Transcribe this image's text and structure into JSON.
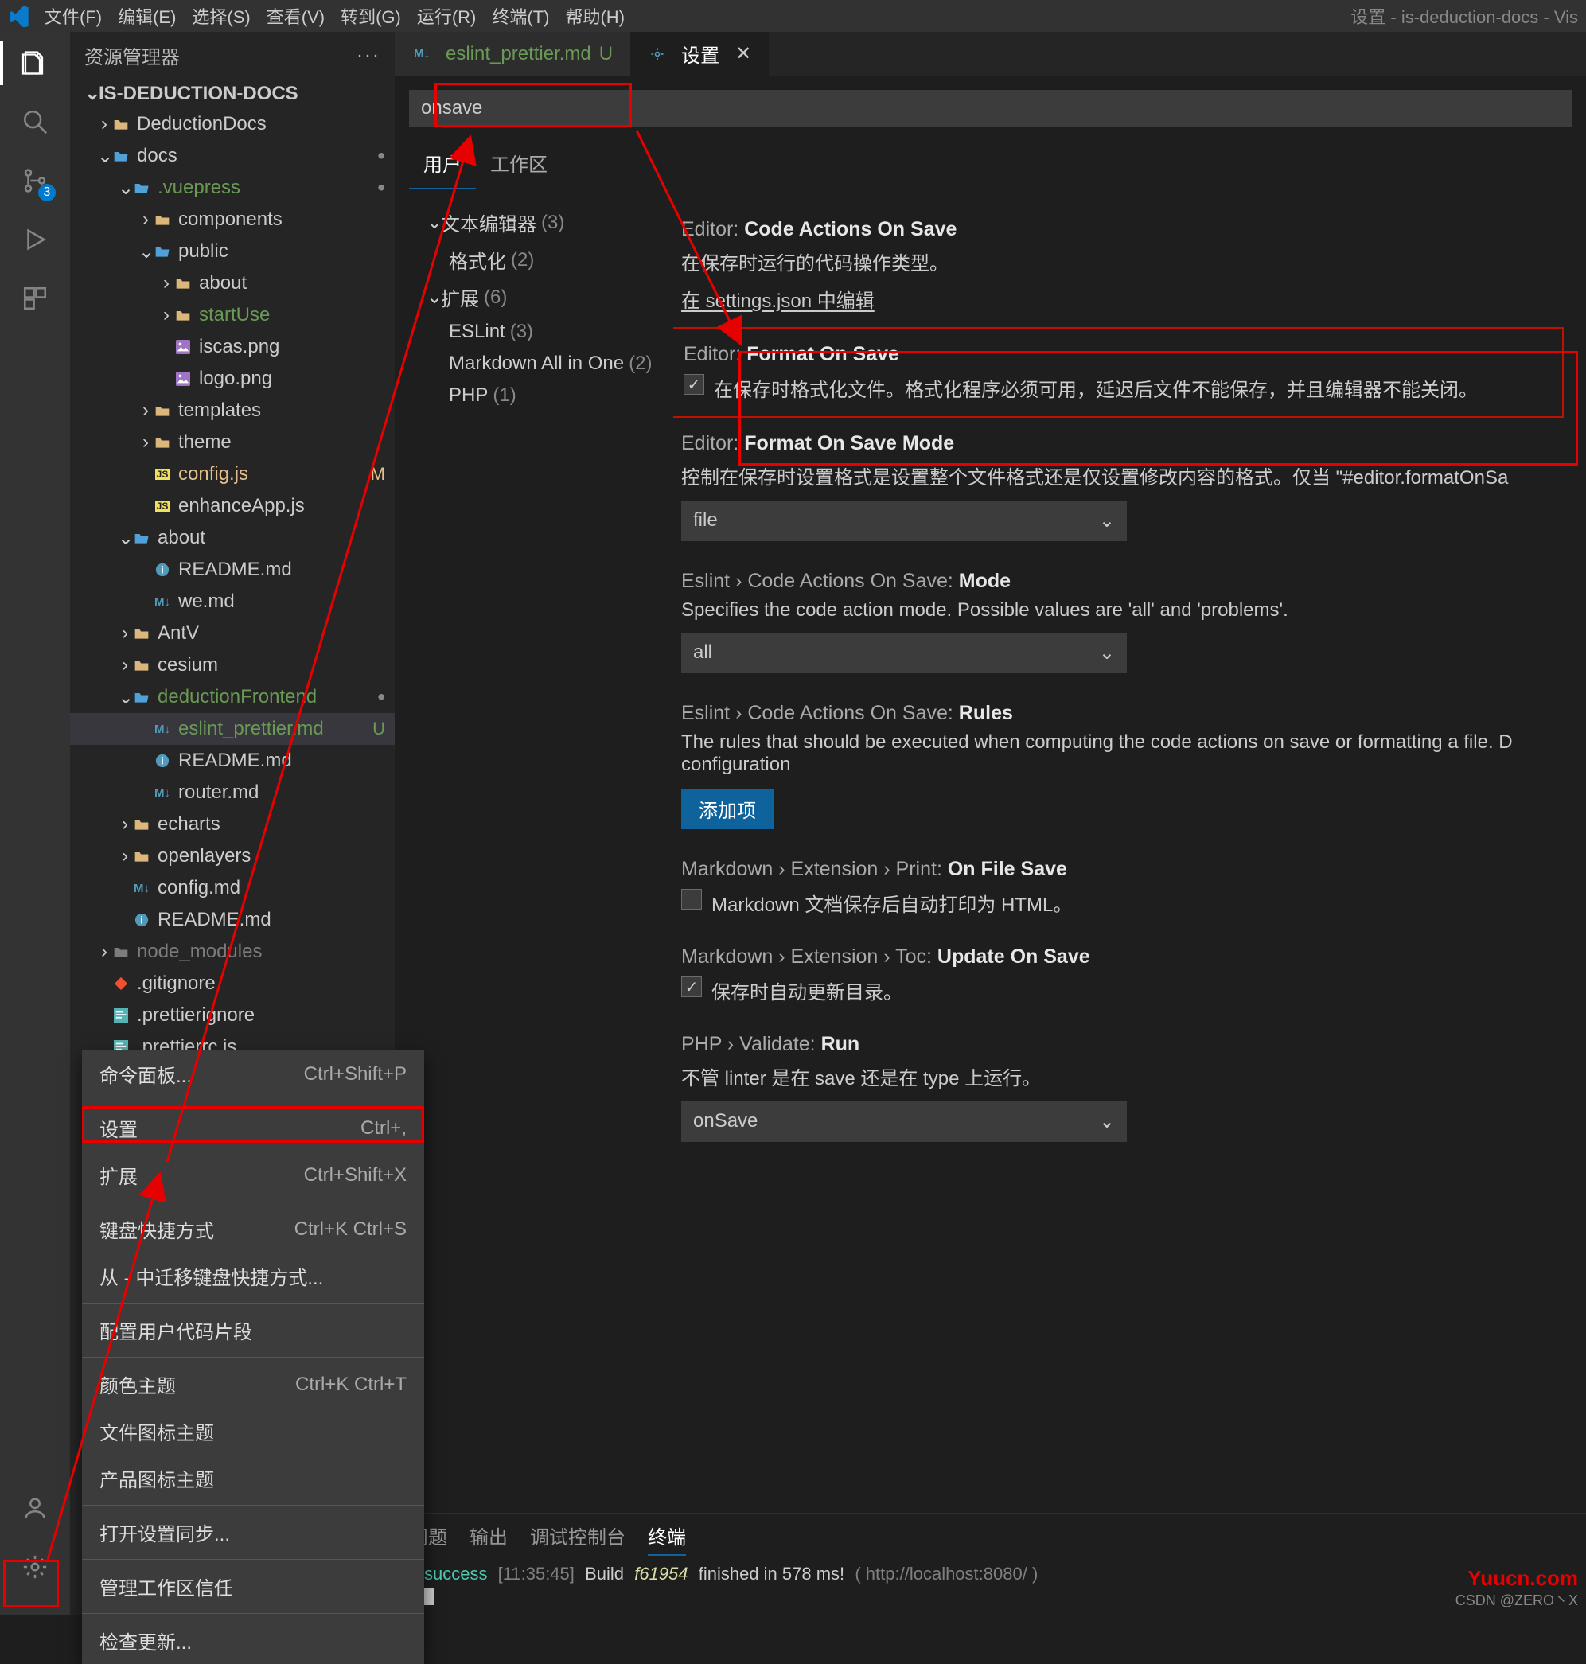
{
  "titlebar": {
    "menus": [
      "文件(F)",
      "编辑(E)",
      "选择(S)",
      "查看(V)",
      "转到(G)",
      "运行(R)",
      "终端(T)",
      "帮助(H)"
    ],
    "windowTitle": "设置 - is-deduction-docs - Vis"
  },
  "activity": {
    "scmBadge": "3"
  },
  "sidebar": {
    "title": "资源管理器",
    "project": "IS-DEDUCTION-DOCS",
    "tree": [
      {
        "d": 1,
        "k": "folder",
        "c": "›",
        "n": "DeductionDocs"
      },
      {
        "d": 1,
        "k": "folder-open",
        "c": "⌄",
        "n": "docs",
        "dot": true
      },
      {
        "d": 2,
        "k": "folder-open",
        "c": "⌄",
        "n": ".vuepress",
        "dot": true,
        "cls": "folder-green"
      },
      {
        "d": 3,
        "k": "folder",
        "c": "›",
        "n": "components"
      },
      {
        "d": 3,
        "k": "folder-open",
        "c": "⌄",
        "n": "public",
        "cls": "folder-blue"
      },
      {
        "d": 4,
        "k": "folder",
        "c": "›",
        "n": "about"
      },
      {
        "d": 4,
        "k": "folder",
        "c": "›",
        "n": "startUse",
        "cls": "name-green"
      },
      {
        "d": 4,
        "k": "img",
        "c": "",
        "n": "iscas.png"
      },
      {
        "d": 4,
        "k": "img",
        "c": "",
        "n": "logo.png"
      },
      {
        "d": 3,
        "k": "folder",
        "c": "›",
        "n": "templates"
      },
      {
        "d": 3,
        "k": "folder",
        "c": "›",
        "n": "theme"
      },
      {
        "d": 3,
        "k": "js",
        "c": "",
        "n": "config.js",
        "cls": "name-ochre",
        "m": "M"
      },
      {
        "d": 3,
        "k": "js",
        "c": "",
        "n": "enhanceApp.js"
      },
      {
        "d": 2,
        "k": "folder-open",
        "c": "⌄",
        "n": "about"
      },
      {
        "d": 3,
        "k": "info",
        "c": "",
        "n": "README.md"
      },
      {
        "d": 3,
        "k": "md",
        "c": "",
        "n": "we.md"
      },
      {
        "d": 2,
        "k": "folder",
        "c": "›",
        "n": "AntV"
      },
      {
        "d": 2,
        "k": "folder",
        "c": "›",
        "n": "cesium"
      },
      {
        "d": 2,
        "k": "folder-open",
        "c": "⌄",
        "n": "deductionFrontend",
        "dot": true,
        "cls": "folder-green"
      },
      {
        "d": 3,
        "k": "md",
        "c": "",
        "n": "eslint_prettier.md",
        "cls": "name-green",
        "sel": true,
        "u": "U"
      },
      {
        "d": 3,
        "k": "info",
        "c": "",
        "n": "README.md"
      },
      {
        "d": 3,
        "k": "md",
        "c": "",
        "n": "router.md"
      },
      {
        "d": 2,
        "k": "folder",
        "c": "›",
        "n": "echarts"
      },
      {
        "d": 2,
        "k": "folder",
        "c": "›",
        "n": "openlayers"
      },
      {
        "d": 2,
        "k": "md",
        "c": "",
        "n": "config.md"
      },
      {
        "d": 2,
        "k": "info",
        "c": "",
        "n": "README.md"
      },
      {
        "d": 1,
        "k": "folder",
        "c": "›",
        "n": "node_modules",
        "cls": "name-dim",
        "folderDim": true
      },
      {
        "d": 1,
        "k": "git",
        "c": "",
        "n": ".gitignore"
      },
      {
        "d": 1,
        "k": "pret",
        "c": "",
        "n": ".prettierignore"
      },
      {
        "d": 1,
        "k": "pret",
        "c": "",
        "n": ".prettierrc.is"
      }
    ]
  },
  "tabs": [
    {
      "icon": "md",
      "label": "eslint_prettier.md",
      "status": "U",
      "active": false
    },
    {
      "icon": "gear",
      "label": "设置",
      "status": "",
      "active": true,
      "close": true
    }
  ],
  "settings": {
    "search": "onsave",
    "scopes": [
      "用户",
      "工作区"
    ],
    "toc": [
      {
        "label": "文本编辑器",
        "count": "(3)",
        "chev": "⌄",
        "d": 0
      },
      {
        "label": "格式化",
        "count": "(2)",
        "d": 1
      },
      {
        "label": "扩展",
        "count": "(6)",
        "chev": "⌄",
        "d": 0
      },
      {
        "label": "ESLint",
        "count": "(3)",
        "d": 1
      },
      {
        "label": "Markdown All in One",
        "count": "(2)",
        "d": 1
      },
      {
        "label": "PHP",
        "count": "(1)",
        "d": 1
      }
    ],
    "items": {
      "codeActions": {
        "scope": "Editor:",
        "title": "Code Actions On Save",
        "desc": "在保存时运行的代码操作类型。",
        "link": "在 settings.json 中编辑"
      },
      "formatOnSave": {
        "scope": "Editor:",
        "title": "Format On Save",
        "desc": "在保存时格式化文件。格式化程序必须可用，延迟后文件不能保存，并且编辑器不能关闭。",
        "checked": true
      },
      "formatMode": {
        "scope": "Editor:",
        "title": "Format On Save Mode",
        "desc": "控制在保存时设置格式是设置整个文件格式还是仅设置修改内容的格式。仅当 \"#editor.formatOnSa",
        "value": "file"
      },
      "eslintMode": {
        "scope": "Eslint › Code Actions On Save:",
        "title": "Mode",
        "desc": "Specifies the code action mode. Possible values are 'all' and 'problems'.",
        "value": "all"
      },
      "eslintRules": {
        "scope": "Eslint › Code Actions On Save:",
        "title": "Rules",
        "desc": "The rules that should be executed when computing the code actions on save or formatting a file. D configuration",
        "button": "添加项"
      },
      "mdPrint": {
        "scope": "Markdown › Extension › Print:",
        "title": "On File Save",
        "desc": "Markdown 文档保存后自动打印为 HTML。",
        "checked": false
      },
      "mdToc": {
        "scope": "Markdown › Extension › Toc:",
        "title": "Update On Save",
        "desc": "保存时自动更新目录。",
        "checked": true
      },
      "php": {
        "scope": "PHP › Validate:",
        "title": "Run",
        "desc": "不管 linter 是在 save 还是在 type 上运行。",
        "value": "onSave"
      }
    }
  },
  "panel": {
    "tabs": [
      "问题",
      "输出",
      "调试控制台",
      "终端"
    ],
    "active": 3,
    "lineSuccess": "success",
    "lineTime": "[11:35:45]",
    "lineBuild": "Build",
    "lineHash": "f61954",
    "lineRest": "finished in 578 ms!",
    "lineUrl": "( http://localhost:8080/ )"
  },
  "contextMenu": [
    {
      "label": "命令面板...",
      "short": "Ctrl+Shift+P"
    },
    {
      "sep": true
    },
    {
      "label": "设置",
      "short": "Ctrl+,",
      "hl": true
    },
    {
      "label": "扩展",
      "short": "Ctrl+Shift+X"
    },
    {
      "sep": true
    },
    {
      "label": "键盘快捷方式",
      "short": "Ctrl+K Ctrl+S"
    },
    {
      "label": "从 - 中迁移键盘快捷方式..."
    },
    {
      "sep": true
    },
    {
      "label": "配置用户代码片段"
    },
    {
      "sep": true
    },
    {
      "label": "颜色主题",
      "short": "Ctrl+K Ctrl+T"
    },
    {
      "label": "文件图标主题"
    },
    {
      "label": "产品图标主题"
    },
    {
      "sep": true
    },
    {
      "label": "打开设置同步..."
    },
    {
      "sep": true
    },
    {
      "label": "管理工作区信任"
    },
    {
      "sep": true
    },
    {
      "label": "检查更新..."
    }
  ],
  "watermark": "Yuucn.com",
  "watermark2": "CSDN @ZERO丶X"
}
